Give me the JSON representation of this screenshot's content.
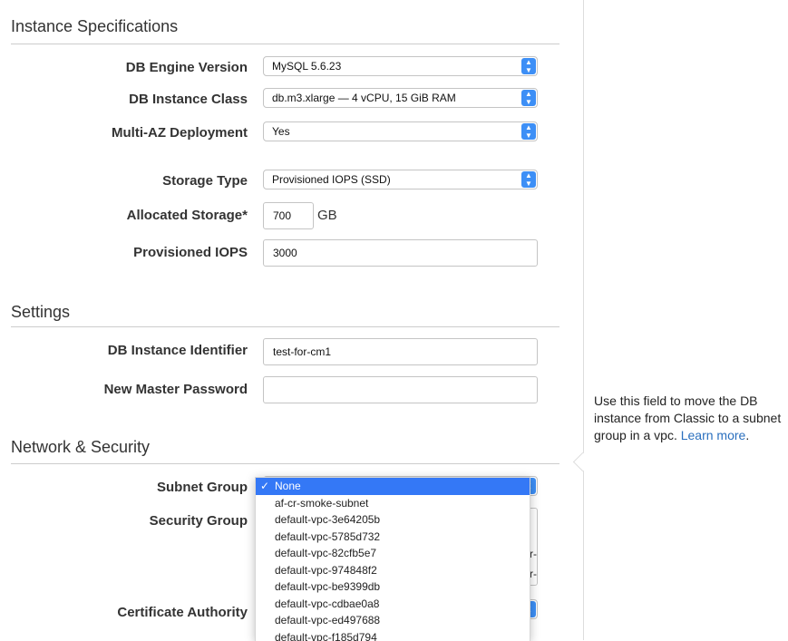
{
  "instance_specs": {
    "title": "Instance Specifications",
    "db_engine_version": {
      "label": "DB Engine Version",
      "value": "MySQL 5.6.23"
    },
    "db_instance_class": {
      "label": "DB Instance Class",
      "value": "db.m3.xlarge — 4 vCPU, 15 GiB RAM"
    },
    "multi_az": {
      "label": "Multi-AZ Deployment",
      "value": "Yes"
    },
    "storage_type": {
      "label": "Storage Type",
      "value": "Provisioned IOPS (SSD)"
    },
    "allocated_storage": {
      "label": "Allocated Storage*",
      "value": "700",
      "unit": "GB"
    },
    "provisioned_iops": {
      "label": "Provisioned IOPS",
      "value": "3000"
    }
  },
  "settings": {
    "title": "Settings",
    "db_instance_identifier": {
      "label": "DB Instance Identifier",
      "value": "test-for-cm1"
    },
    "new_master_password": {
      "label": "New Master Password",
      "value": ""
    }
  },
  "network": {
    "title": "Network & Security",
    "subnet_group": {
      "label": "Subnet Group"
    },
    "security_group": {
      "label": "Security Group"
    },
    "certificate_authority": {
      "label": "Certificate Authority"
    },
    "partial_text_1": "r-",
    "partial_text_2": "r-"
  },
  "dropdown": {
    "selected": "None",
    "check_mark": "✓",
    "items": [
      "af-cr-smoke-subnet",
      "default-vpc-3e64205b",
      "default-vpc-5785d732",
      "default-vpc-82cfb5e7",
      "default-vpc-974848f2",
      "default-vpc-be9399db",
      "default-vpc-cdbae0a8",
      "default-vpc-ed497688",
      "default-vpc-f185d794"
    ]
  },
  "help": {
    "text": "Use this field to move the DB instance from Classic to a subnet group in a vpc.",
    "link": "Learn more",
    "trailing": "."
  }
}
